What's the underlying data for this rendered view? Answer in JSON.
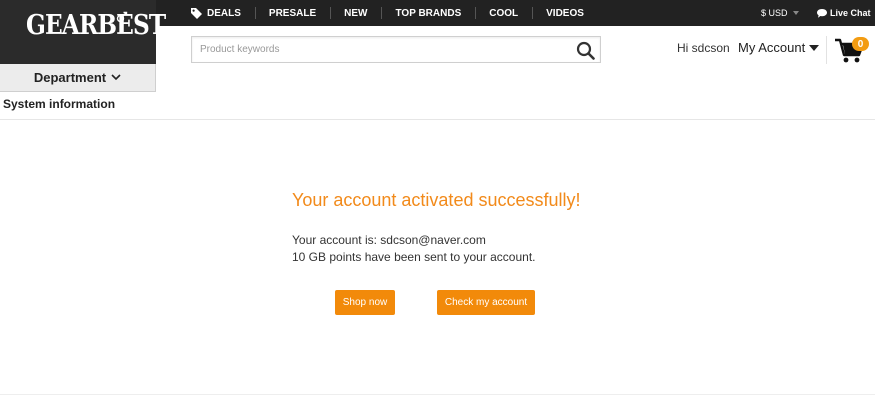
{
  "brand": {
    "logo_text": "GEARBEST"
  },
  "topnav": {
    "items": [
      {
        "label": "DEALS",
        "icon": "tag-icon"
      },
      {
        "label": "PRESALE"
      },
      {
        "label": "NEW"
      },
      {
        "label": "TOP BRANDS"
      },
      {
        "label": "COOL"
      },
      {
        "label": "VIDEOS"
      }
    ],
    "currency": "$ USD",
    "live_chat": "Live Chat"
  },
  "department": {
    "label": "Department"
  },
  "search": {
    "placeholder": "Product keywords",
    "value": "",
    "icon": "search-icon"
  },
  "account": {
    "greeting": "Hi sdcson",
    "menu_label": "My Account",
    "cart_count": "0",
    "cart_icon": "cart-icon"
  },
  "page": {
    "section_title": "System information"
  },
  "message": {
    "title": "Your account activated successfully!",
    "line1": "Your account is: sdcson@naver.com",
    "line2": "10 GB points have been sent to your account."
  },
  "actions": {
    "shop_now": "Shop now",
    "check_account": "Check my account"
  },
  "colors": {
    "accent": "#f28a0a",
    "topbar": "#222222",
    "logo_bg": "#2b2b2b",
    "title_orange": "#f28a1a"
  }
}
